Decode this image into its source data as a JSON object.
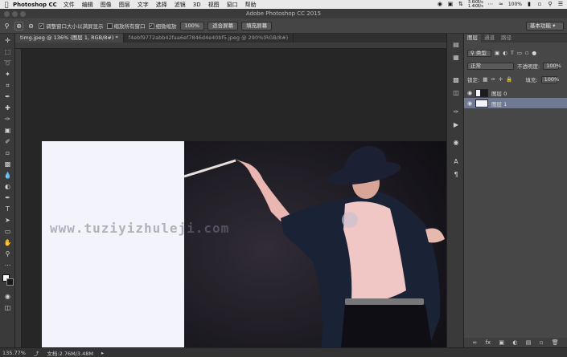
{
  "menubar": {
    "app_name": "Photoshop CC",
    "items": [
      "文件",
      "编辑",
      "图像",
      "图层",
      "文字",
      "选择",
      "滤镜",
      "3D",
      "视图",
      "窗口",
      "帮助"
    ],
    "net_up": "3.6KB/s",
    "net_down": "1.4KB/s",
    "battery": "100%"
  },
  "window": {
    "title": "Adobe Photoshop CC 2015"
  },
  "options": {
    "resize_windows": "调整窗口大小以满屏显示",
    "zoom_all_windows": "缩放所有窗口",
    "scrubby_zoom": "细微缩放",
    "zoom_value": "100%",
    "fit_screen": "适合屏幕",
    "fill_screen": "填充屏幕",
    "workspace": "基本功能"
  },
  "tabs": [
    {
      "label": "timg.jpeg @ 136% (图层 1, RGB/8#) *"
    },
    {
      "label": "f4ebf9772abb42faa6ef7846d4e40bf5.jpeg @ 290%(RGB/8#)"
    }
  ],
  "canvas": {
    "watermark": "www.tuziyizhuleji.com",
    "panel_color": "#f3f3fb"
  },
  "panel": {
    "tabs": [
      "图层",
      "通道",
      "路径"
    ],
    "filter_kind": "类型",
    "blend_mode": "正常",
    "opacity_label": "不透明度:",
    "opacity_value": "100%",
    "lock_label": "锁定:",
    "fill_label": "填充:",
    "fill_value": "100%",
    "layers": [
      {
        "name": "图层 0",
        "selected": false
      },
      {
        "name": "图层 1",
        "selected": true
      }
    ]
  },
  "status": {
    "zoom": "135.77%",
    "doc_size": "文档:2.76M/3.48M"
  }
}
